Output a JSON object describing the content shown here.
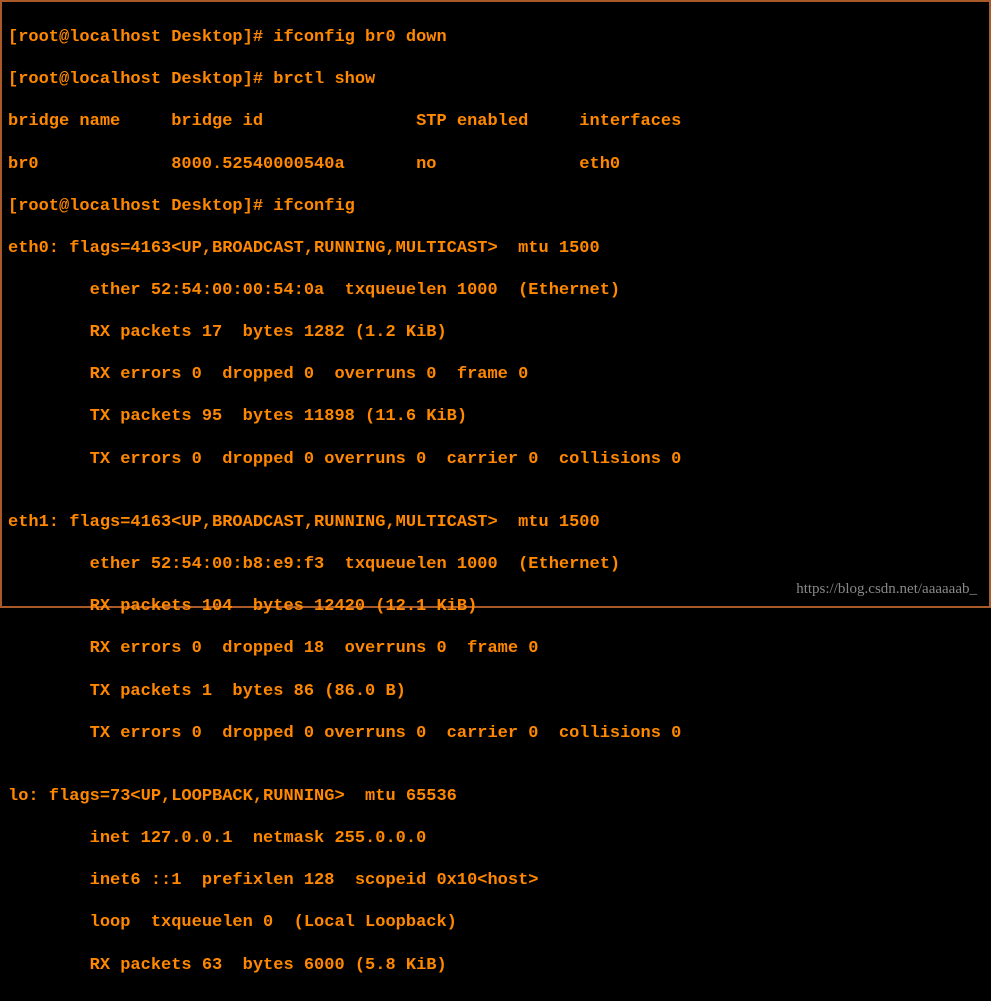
{
  "lines": {
    "l0": "[root@localhost Desktop]# ifconfig br0 down",
    "l1": "[root@localhost Desktop]# brctl show",
    "l2": "bridge name     bridge id               STP enabled     interfaces",
    "l3": "br0             8000.52540000540a       no              eth0",
    "l4": "[root@localhost Desktop]# ifconfig",
    "l5": "eth0: flags=4163<UP,BROADCAST,RUNNING,MULTICAST>  mtu 1500",
    "l6": "        ether 52:54:00:00:54:0a  txqueuelen 1000  (Ethernet)",
    "l7": "        RX packets 17  bytes 1282 (1.2 KiB)",
    "l8": "        RX errors 0  dropped 0  overruns 0  frame 0",
    "l9": "        TX packets 95  bytes 11898 (11.6 KiB)",
    "l10": "        TX errors 0  dropped 0 overruns 0  carrier 0  collisions 0",
    "l11": "",
    "l12": "eth1: flags=4163<UP,BROADCAST,RUNNING,MULTICAST>  mtu 1500",
    "l13": "        ether 52:54:00:b8:e9:f3  txqueuelen 1000  (Ethernet)",
    "l14": "        RX packets 104  bytes 12420 (12.1 KiB)",
    "l15": "        RX errors 0  dropped 18  overruns 0  frame 0",
    "l16": "        TX packets 1  bytes 86 (86.0 B)",
    "l17": "        TX errors 0  dropped 0 overruns 0  carrier 0  collisions 0",
    "l18": "",
    "l19": "lo: flags=73<UP,LOOPBACK,RUNNING>  mtu 65536",
    "l20": "        inet 127.0.0.1  netmask 255.0.0.0",
    "l21": "        inet6 ::1  prefixlen 128  scopeid 0x10<host>",
    "l22": "        loop  txqueuelen 0  (Local Loopback)",
    "l23": "        RX packets 63  bytes 6000 (5.8 KiB)"
  },
  "watermark": "https://blog.csdn.net/aaaaaab_"
}
